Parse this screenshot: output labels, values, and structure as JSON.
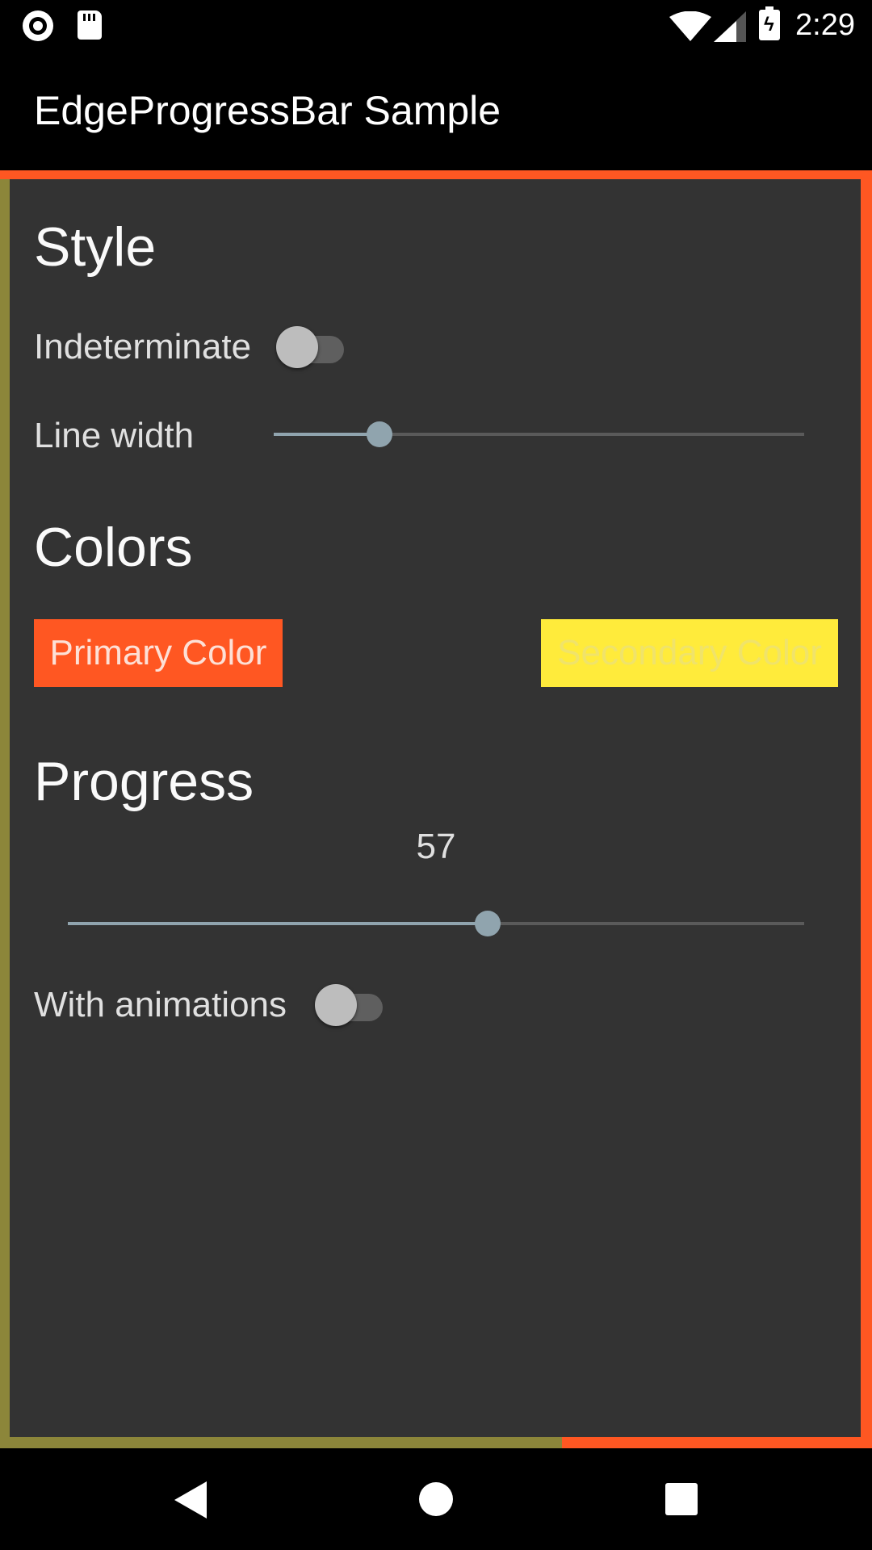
{
  "status_bar": {
    "time": "2:29",
    "battery_glyph": "ϟ",
    "icons": [
      "screen-record-icon",
      "sd-card-icon",
      "wifi-icon",
      "cell-signal-icon",
      "battery-charging-icon"
    ]
  },
  "app_bar": {
    "title": "EdgeProgressBar Sample"
  },
  "sections": {
    "style": {
      "title": "Style",
      "indeterminate_label": "Indeterminate",
      "indeterminate_on": false,
      "line_width_label": "Line width",
      "line_width_fraction": 0.2
    },
    "colors": {
      "title": "Colors",
      "primary_label": "Primary Color",
      "primary_color": "#ff5722",
      "secondary_label": "Secondary Color",
      "secondary_color": "#ffeb3b"
    },
    "progress": {
      "title": "Progress",
      "value": "57",
      "slider_fraction": 0.57,
      "animations_label": "With animations",
      "animations_on": false
    }
  },
  "edge_progress": {
    "primary_color": "#ff5722",
    "secondary_color": "#8c863a",
    "content_color": "#333333"
  },
  "nav_bar": {
    "icons": [
      "back-icon",
      "home-icon",
      "recents-icon"
    ]
  }
}
